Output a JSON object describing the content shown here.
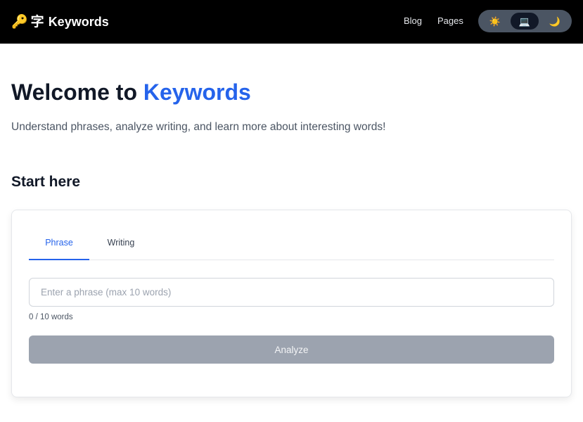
{
  "header": {
    "brand": {
      "key_glyph": "🔑",
      "zi_glyph": "字",
      "name": "Keywords"
    },
    "nav": {
      "blog": "Blog",
      "pages": "Pages"
    },
    "theme_toggle": {
      "light_glyph": "☀️",
      "system_glyph": "💻",
      "dark_glyph": "🌙",
      "selected": "system"
    }
  },
  "hero": {
    "title_prefix": "Welcome to ",
    "title_accent": "Keywords",
    "subtitle": "Understand phrases, analyze writing, and learn more about interesting words!"
  },
  "section": {
    "title": "Start here"
  },
  "card": {
    "tabs": [
      {
        "label": "Phrase",
        "active": true
      },
      {
        "label": "Writing",
        "active": false
      }
    ],
    "input": {
      "value": "",
      "placeholder": "Enter a phrase (max 10 words)"
    },
    "word_count": "0 / 10 words",
    "analyze_label": "Analyze"
  },
  "colors": {
    "accent": "#2563eb",
    "header_bg": "#000000",
    "disabled_button": "#9ca3af"
  }
}
